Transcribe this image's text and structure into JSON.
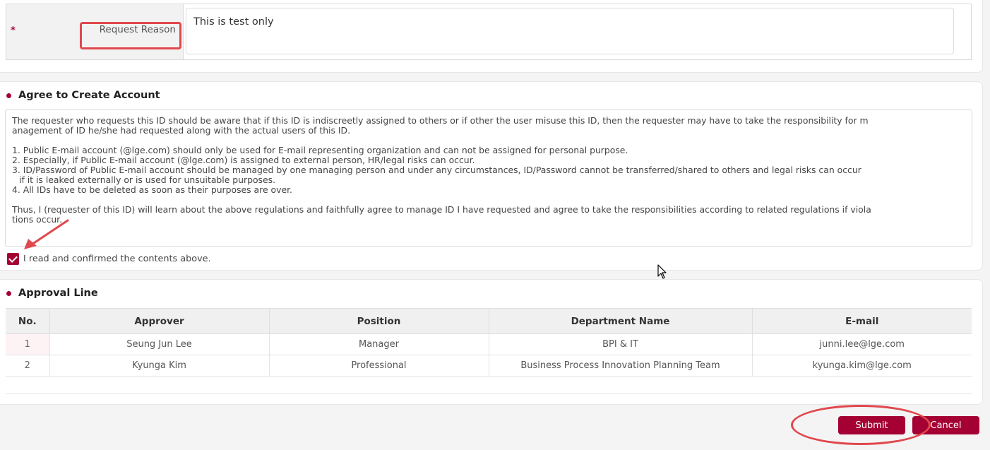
{
  "request_reason": {
    "required_mark": "*",
    "label": "Request Reason",
    "value": "This is test only"
  },
  "agree": {
    "title": "Agree to Create Account",
    "terms_lines": [
      "The requester who requests this ID should be aware that if this ID is indiscreetly assigned to others or if other the user misuse this ID, then the requester may have to take the responsibility for m",
      "anagement of ID he/she had requested along with the actual users of this ID.",
      "",
      "1. Public E-mail account (@lge.com) should only be used for E-mail representing organization and can not be assigned for personal purpose.",
      "2. Especially, if Public E-mail account (@lge.com) is assigned to external person, HR/legal risks can occur.",
      "3. ID/Password of Public E-mail account should be managed by one managing person and under any circumstances, ID/Password cannot be transferred/shared to others and legal risks can occur",
      "if it is leaked externally or is used for unsuitable purposes.",
      "4. All IDs have to be deleted as soon as their purposes are over.",
      "",
      "Thus, I (requester of this ID) will learn about the above regulations and faithfully agree to manage ID I have requested and agree to take the responsibilities according to related regulations if viola",
      "tions occur."
    ],
    "confirm_label": "I read and confirmed the contents above.",
    "confirmed": true
  },
  "approval": {
    "title": "Approval Line",
    "columns": [
      "No.",
      "Approver",
      "Position",
      "Department Name",
      "E-mail"
    ],
    "rows": [
      [
        "1",
        "Seung Jun Lee",
        "Manager",
        "BPI & IT",
        "junni.lee@lge.com"
      ],
      [
        "2",
        "Kyunga Kim",
        "Professional",
        "Business Process Innovation Planning Team",
        "kyunga.kim@lge.com"
      ]
    ]
  },
  "buttons": {
    "submit": "Submit",
    "cancel": "Cancel"
  },
  "colors": {
    "accent": "#a50034",
    "annotation_red": "#e0484d"
  }
}
